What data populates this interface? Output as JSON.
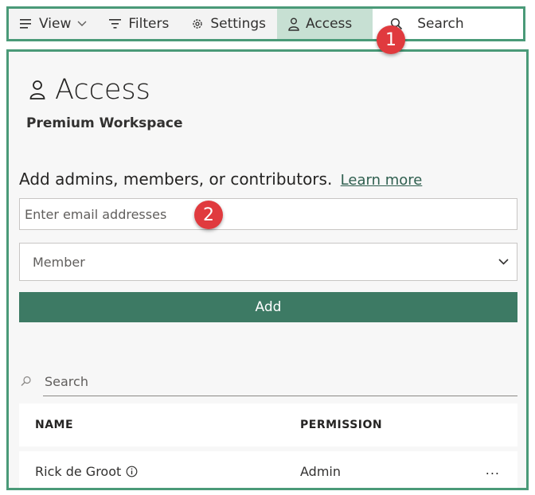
{
  "toolbar": {
    "items": [
      {
        "label": "View",
        "icon": "hamburger-icon"
      },
      {
        "label": "Filters",
        "icon": "filter-icon"
      },
      {
        "label": "Settings",
        "icon": "gear-icon"
      },
      {
        "label": "Access",
        "icon": "person-icon",
        "active": true
      }
    ],
    "search_label": "Search"
  },
  "callouts": [
    "1",
    "2"
  ],
  "panel": {
    "title": "Access",
    "subtitle": "Premium Workspace",
    "intro_text": "Add admins, members, or contributors.",
    "learn_more": "Learn more",
    "email_placeholder": "Enter email addresses",
    "role_selected": "Member",
    "add_label": "Add",
    "search_placeholder": "Search",
    "table": {
      "columns": [
        "NAME",
        "PERMISSION"
      ],
      "rows": [
        {
          "name": "Rick de Groot",
          "permission": "Admin",
          "more": "..."
        }
      ]
    }
  },
  "colors": {
    "accent": "#3d7a64",
    "active_tab": "#c7e0d3",
    "border_highlight": "#4a9a78",
    "badge": "#e03a3e"
  }
}
